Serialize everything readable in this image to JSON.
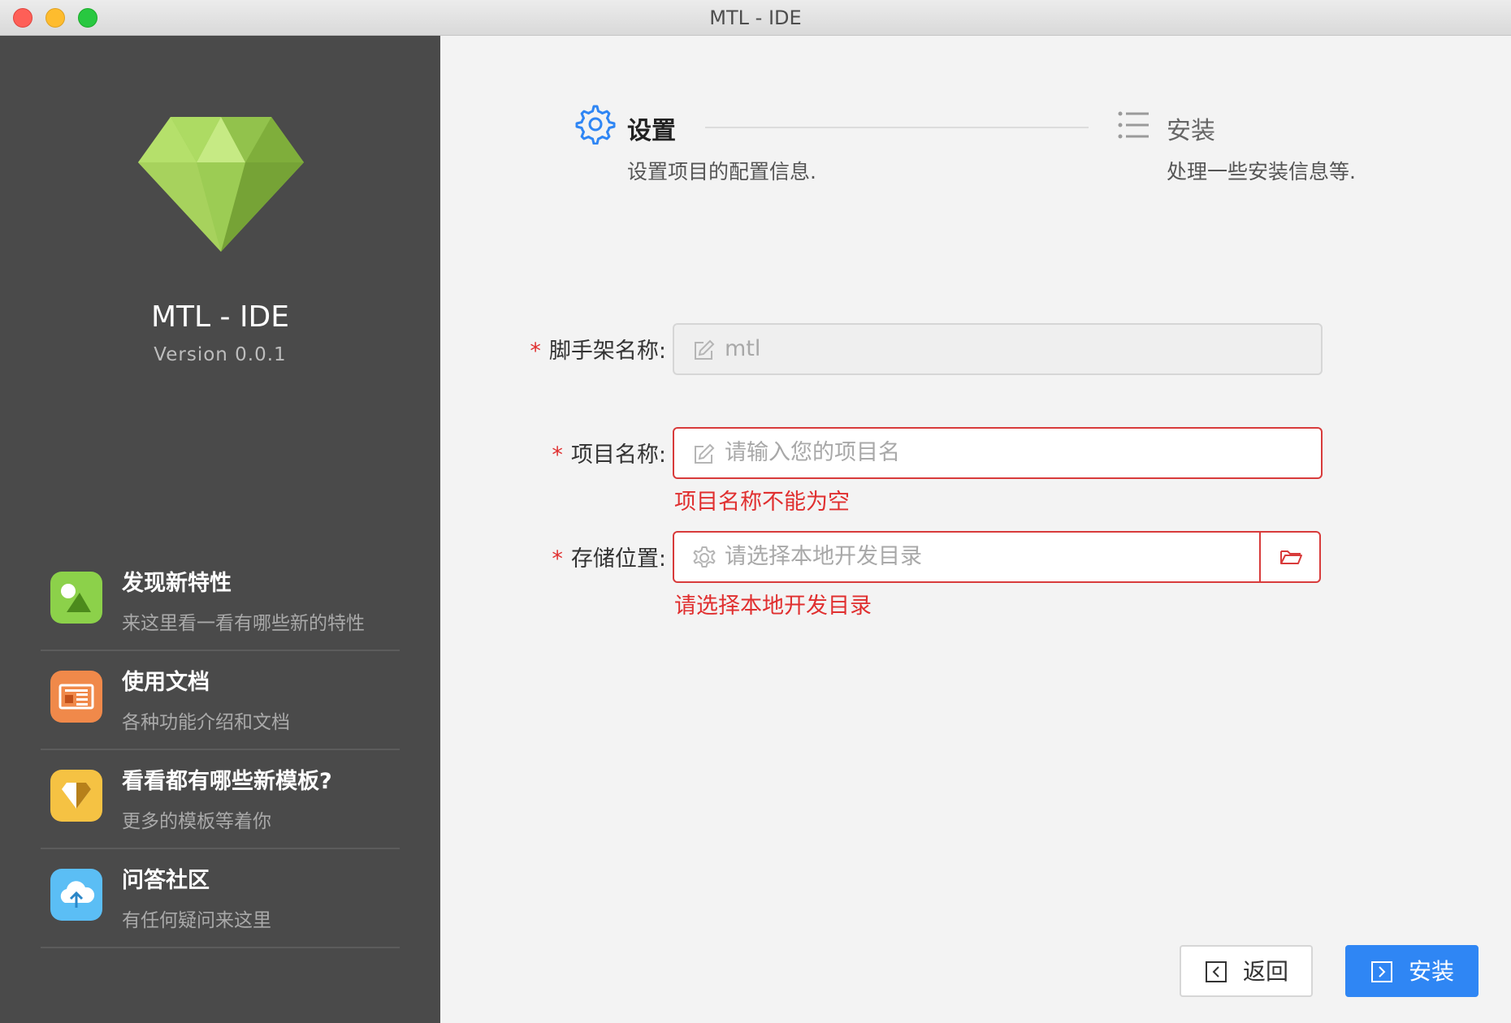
{
  "window": {
    "title": "MTL - IDE"
  },
  "sidebar": {
    "app_name": "MTL - IDE",
    "version": "Version 0.0.1",
    "logo_icon": "green-gem-icon",
    "items": [
      {
        "title": "发现新特性",
        "desc": "来这里看一看有哪些新的特性",
        "icon": "image-icon",
        "color": "#8cd14a"
      },
      {
        "title": "使用文档",
        "desc": "各种功能介绍和文档",
        "icon": "document-icon",
        "color": "#f0894a"
      },
      {
        "title": "看看都有哪些新模板?",
        "desc": "更多的模板等着你",
        "icon": "gem-template-icon",
        "color": "#f5c243"
      },
      {
        "title": "问答社区",
        "desc": "有任何疑问来这里",
        "icon": "cloud-upload-icon",
        "color": "#5bbef5"
      }
    ]
  },
  "steps": [
    {
      "title": "设置",
      "desc": "设置项目的配置信息.",
      "icon": "gear-icon",
      "active": true
    },
    {
      "title": "安装",
      "desc": "处理一些安装信息等.",
      "icon": "list-icon",
      "active": false
    }
  ],
  "form": {
    "scaffold": {
      "label": "脚手架名称:",
      "value": "mtl",
      "icon": "edit-icon"
    },
    "project": {
      "label": "项目名称:",
      "placeholder": "请输入您的项目名",
      "error": "项目名称不能为空",
      "icon": "edit-icon"
    },
    "location": {
      "label": "存储位置:",
      "placeholder": "请选择本地开发目录",
      "error": "请选择本地开发目录",
      "icon": "gear-icon",
      "suffix_icon": "folder-open-icon"
    }
  },
  "buttons": {
    "back": {
      "label": "返回",
      "icon": "arrow-left-square-icon"
    },
    "install": {
      "label": "安装",
      "icon": "arrow-right-square-icon"
    }
  },
  "colors": {
    "accent": "#2f86f4",
    "error": "#e02f2f",
    "sidebar_bg": "#4a4a4a"
  }
}
